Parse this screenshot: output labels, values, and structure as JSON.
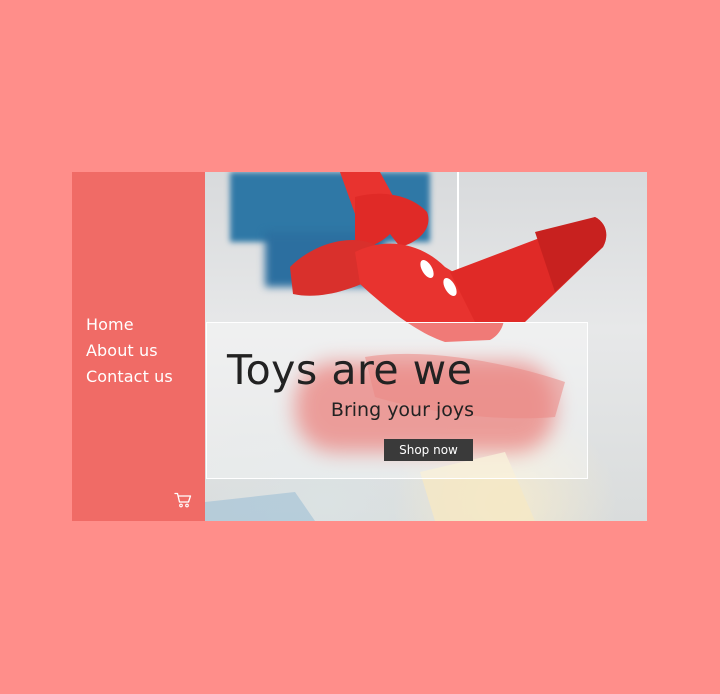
{
  "nav": {
    "items": [
      {
        "label": "Home"
      },
      {
        "label": "About us"
      },
      {
        "label": "Contact us"
      }
    ],
    "cart_icon": "shopping-cart-icon"
  },
  "hero": {
    "headline": "Toys are we",
    "tagline": "Bring your joys",
    "cta_label": "Shop now"
  },
  "colors": {
    "page_background": "#FF8E8A",
    "sidebar": "#F06B66",
    "plane_red": "#E8332F",
    "button": "#3A3A3A"
  }
}
